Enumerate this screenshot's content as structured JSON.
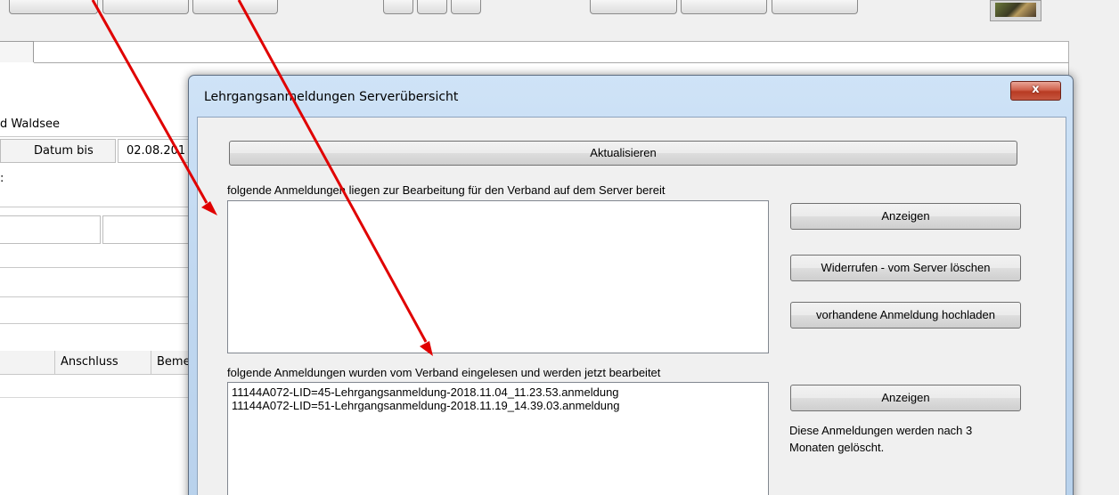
{
  "background_app": {
    "location_text": "d Waldsee",
    "date_to_label": "Datum bis",
    "date_to_value": "02.08.201",
    "colon_text": ":",
    "table_headers": [
      "Anschluss",
      "Beme"
    ]
  },
  "dialog": {
    "title": "Lehrgangsanmeldungen Serverübersicht",
    "close_symbol": "x",
    "refresh_label": "Aktualisieren",
    "pending": {
      "label": "folgende Anmeldungen liegen zur Bearbeitung für den Verband auf dem Server bereit",
      "items": [],
      "show_label": "Anzeigen",
      "revoke_label": "Widerrufen - vom Server löschen",
      "upload_label": "vorhandene Anmeldung hochladen"
    },
    "processed": {
      "label": "folgende Anmeldungen wurden vom Verband eingelesen und werden jetzt bearbeitet",
      "items": [
        "11144A072-LID=45-Lehrgangsanmeldung-2018.11.04_11.23.53.anmeldung",
        "11144A072-LID=51-Lehrgangsanmeldung-2018.11.19_14.39.03.anmeldung"
      ],
      "show_label": "Anzeigen",
      "note": "Diese Anmeldungen werden nach 3 Monaten gelöscht."
    }
  },
  "annotation": {
    "arrow_color": "#e00000"
  },
  "colors": {
    "dialog_frame": "#c2d9f1",
    "close_button": "#c65740",
    "dialog_body": "#f0f0f0"
  }
}
